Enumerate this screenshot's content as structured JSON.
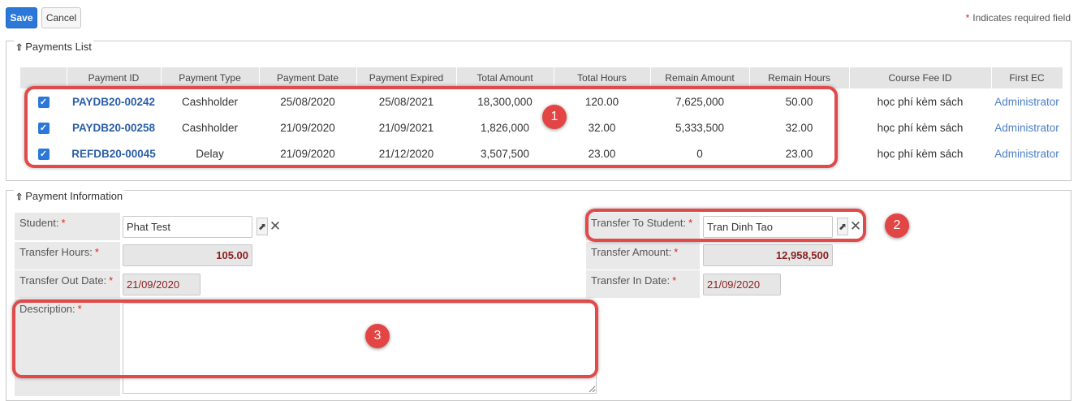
{
  "toolbar": {
    "save_label": "Save",
    "cancel_label": "Cancel",
    "required_note": "Indicates required field",
    "required_star": "*"
  },
  "payments_panel": {
    "title": "Payments List",
    "columns": [
      "",
      "Payment ID",
      "Payment Type",
      "Payment Date",
      "Payment Expired",
      "Total Amount",
      "Total Hours",
      "Remain Amount",
      "Remain Hours",
      "Course Fee ID",
      "First EC"
    ],
    "rows": [
      {
        "checked": true,
        "payment_id": "PAYDB20-00242",
        "payment_type": "Cashholder",
        "payment_date": "25/08/2020",
        "payment_expired": "25/08/2021",
        "total_amount": "18,300,000",
        "total_hours": "120.00",
        "remain_amount": "7,625,000",
        "remain_hours": "50.00",
        "course_fee_id": "học phí kèm sách",
        "first_ec": "Administrator"
      },
      {
        "checked": true,
        "payment_id": "PAYDB20-00258",
        "payment_type": "Cashholder",
        "payment_date": "21/09/2020",
        "payment_expired": "21/09/2021",
        "total_amount": "1,826,000",
        "total_hours": "32.00",
        "remain_amount": "5,333,500",
        "remain_hours": "32.00",
        "course_fee_id": "học phí kèm sách",
        "first_ec": "Administrator"
      },
      {
        "checked": true,
        "payment_id": "REFDB20-00045",
        "payment_type": "Delay",
        "payment_date": "21/09/2020",
        "payment_expired": "21/12/2020",
        "total_amount": "3,507,500",
        "total_hours": "23.00",
        "remain_amount": "0",
        "remain_hours": "23.00",
        "course_fee_id": "học phí kèm sách",
        "first_ec": "Administrator"
      }
    ]
  },
  "info_panel": {
    "title": "Payment Information",
    "student_label": "Student:",
    "student_value": "Phat Test",
    "transfer_hours_label": "Transfer Hours:",
    "transfer_hours_value": "105.00",
    "transfer_out_date_label": "Transfer Out Date:",
    "transfer_out_date_value": "21/09/2020",
    "description_label": "Description:",
    "description_value": "",
    "transfer_to_student_label": "Transfer To Student:",
    "transfer_to_student_value": "Tran Dinh Tao",
    "transfer_amount_label": "Transfer Amount:",
    "transfer_amount_value": "12,958,500",
    "transfer_in_date_label": "Transfer In Date:",
    "transfer_in_date_value": "21/09/2020",
    "required_star": "*"
  },
  "annotations": {
    "badge1": "1",
    "badge2": "2",
    "badge3": "3",
    "highlight_color": "#e04a4a"
  },
  "icons": {
    "select": "cursor-arrow-icon",
    "clear": "close-icon",
    "collapse": "chevron-double-up-icon",
    "check": "checkmark-icon"
  }
}
